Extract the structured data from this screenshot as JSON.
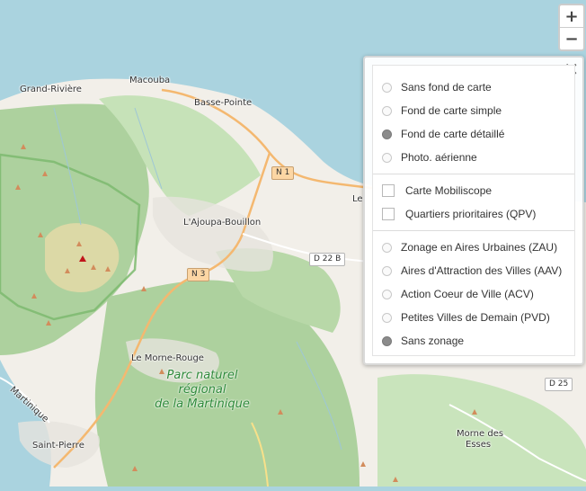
{
  "map": {
    "places": [
      {
        "name": "Grand-Rivière"
      },
      {
        "name": "Macouba"
      },
      {
        "name": "Basse-Pointe"
      },
      {
        "name": "L'Ajoupa-Bouillon"
      },
      {
        "name": "Le Morne-Rouge"
      },
      {
        "name": "Saint-Pierre"
      },
      {
        "name": "Morne des"
      },
      {
        "name": "Esses"
      },
      {
        "name": "Le"
      },
      {
        "name": "Martinique"
      }
    ],
    "roads": [
      "N 1",
      "N 3",
      "D 22 B",
      "D 25"
    ],
    "park_lines": [
      "Parc naturel",
      "régional",
      "de la Martinique"
    ]
  },
  "zoom": {
    "in": "+",
    "out": "−"
  },
  "layers": {
    "close": "✕",
    "basemaps": [
      {
        "label": "Sans fond de carte",
        "checked": false
      },
      {
        "label": "Fond de carte simple",
        "checked": false
      },
      {
        "label": "Fond de carte détaillé",
        "checked": true
      },
      {
        "label": "Photo. aérienne",
        "checked": false
      }
    ],
    "overlays": [
      {
        "label": "Carte Mobiliscope",
        "checked": false
      },
      {
        "label": "Quartiers prioritaires (QPV)",
        "checked": false
      }
    ],
    "zonages": [
      {
        "label": "Zonage en Aires Urbaines (ZAU)",
        "checked": false
      },
      {
        "label": "Aires d'Attraction des Villes (AAV)",
        "checked": false
      },
      {
        "label": "Action Coeur de Ville (ACV)",
        "checked": false
      },
      {
        "label": "Petites Villes de Demain (PVD)",
        "checked": false
      },
      {
        "label": "Sans zonage",
        "checked": true
      }
    ]
  },
  "colors": {
    "sea": "#aad3df",
    "land": "#f2efe9",
    "forest": "#add19e",
    "park": "#c8facc",
    "volcano": "#e1d9a6",
    "road": "#fcd6a4"
  }
}
